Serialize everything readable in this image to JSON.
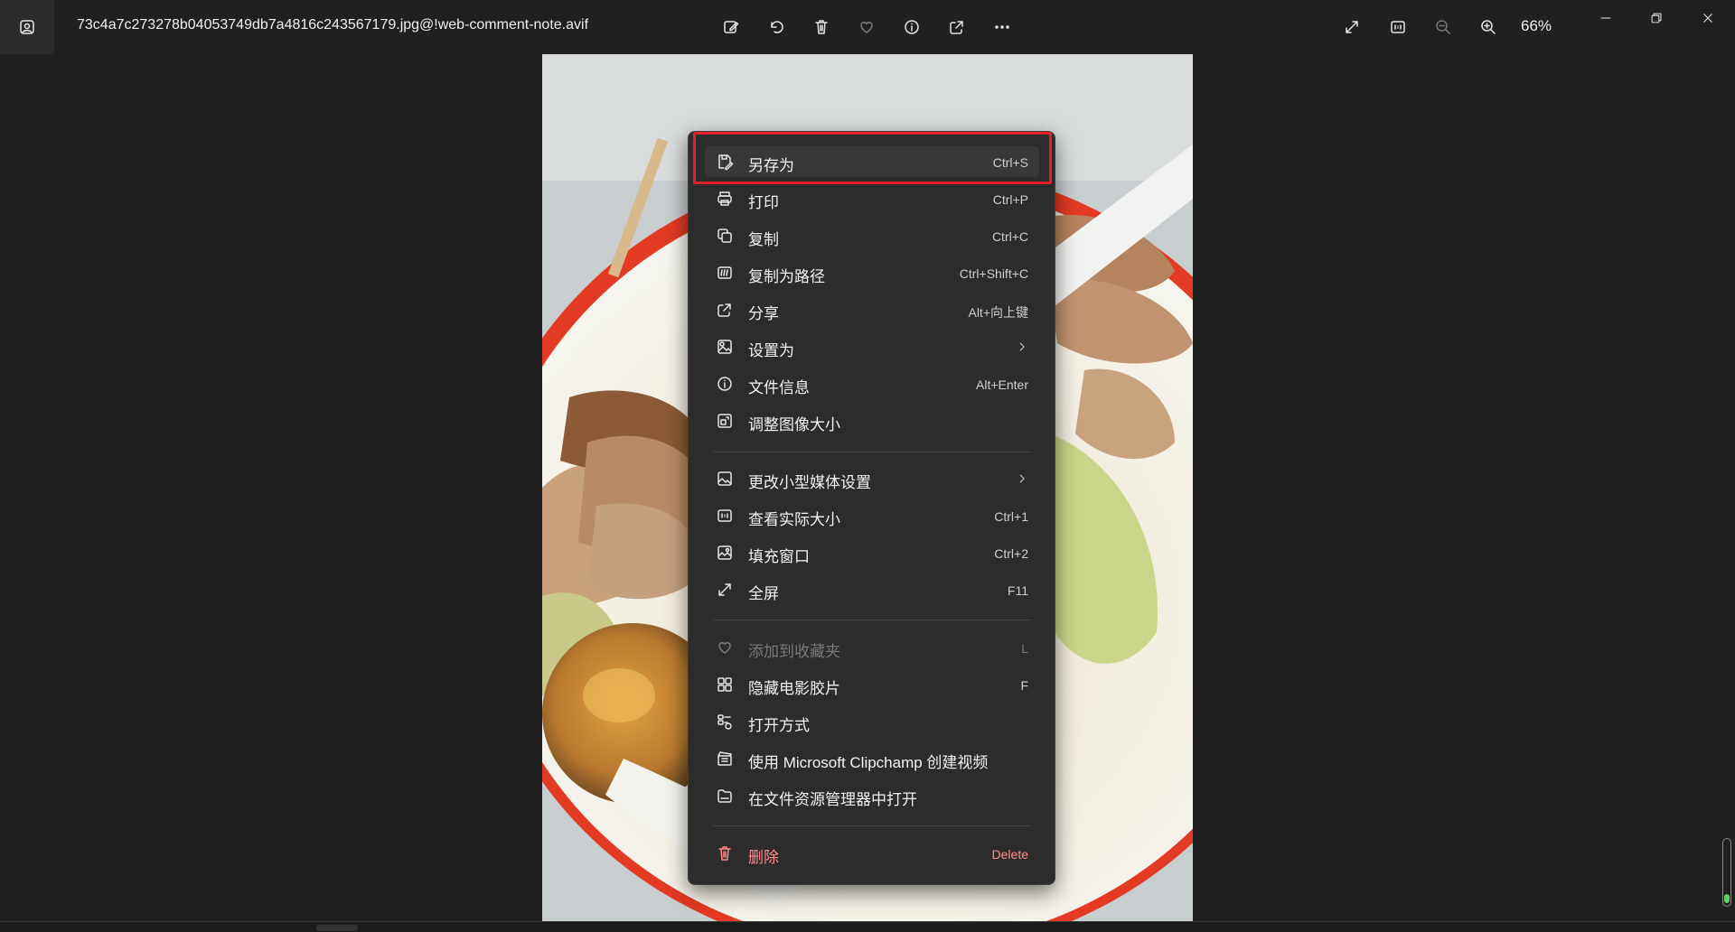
{
  "titlebar": {
    "filename": "73c4a7c273278b04053749db7a4816c243567179.jpg@!web-comment-note.avif",
    "zoom_level": "66%"
  },
  "toolbar_icons": [
    "edit-icon",
    "rotate-icon",
    "delete-icon",
    "favorite-icon",
    "info-icon",
    "share-icon",
    "more-icon"
  ],
  "view_icons": [
    "fullscreen-icon",
    "actual-size-icon",
    "zoom-out-icon",
    "zoom-in-icon"
  ],
  "window_controls": [
    "minimize-icon",
    "restore-icon",
    "close-icon"
  ],
  "context_menu": {
    "items": [
      {
        "label": "另存为",
        "shortcut": "Ctrl+S",
        "icon": "save-as-icon"
      },
      {
        "label": "打印",
        "shortcut": "Ctrl+P",
        "icon": "print-icon"
      },
      {
        "label": "复制",
        "shortcut": "Ctrl+C",
        "icon": "copy-icon"
      },
      {
        "label": "复制为路径",
        "shortcut": "Ctrl+Shift+C",
        "icon": "copy-path-icon"
      },
      {
        "label": "分享",
        "shortcut": "Alt+向上键",
        "icon": "share-icon"
      },
      {
        "label": "设置为",
        "shortcut": "",
        "icon": "set-as-icon"
      },
      {
        "label": "文件信息",
        "shortcut": "Alt+Enter",
        "icon": "file-info-icon"
      },
      {
        "label": "调整图像大小",
        "shortcut": "",
        "icon": "resize-icon"
      },
      {
        "label": "更改小型媒体设置",
        "shortcut": "",
        "icon": "media-settings-icon"
      },
      {
        "label": "查看实际大小",
        "shortcut": "Ctrl+1",
        "icon": "actual-size-icon"
      },
      {
        "label": "填充窗口",
        "shortcut": "Ctrl+2",
        "icon": "fill-window-icon"
      },
      {
        "label": "全屏",
        "shortcut": "F11",
        "icon": "fullscreen-icon"
      },
      {
        "label": "添加到收藏夹",
        "shortcut": "L",
        "icon": "heart-icon"
      },
      {
        "label": "隐藏电影胶片",
        "shortcut": "F",
        "icon": "filmstrip-icon"
      },
      {
        "label": "打开方式",
        "shortcut": "",
        "icon": "open-with-icon"
      },
      {
        "label": "使用 Microsoft Clipchamp 创建视频",
        "shortcut": "",
        "icon": "clipchamp-icon"
      },
      {
        "label": "在文件资源管理器中打开",
        "shortcut": "",
        "icon": "folder-icon"
      },
      {
        "label": "删除",
        "shortcut": "Delete",
        "icon": "trash-icon"
      }
    ]
  },
  "colors": {
    "background": "#202020",
    "menu_background": "#2c2c2c",
    "highlight_box": "#e0202a",
    "delete_text": "#ff8b8b"
  }
}
